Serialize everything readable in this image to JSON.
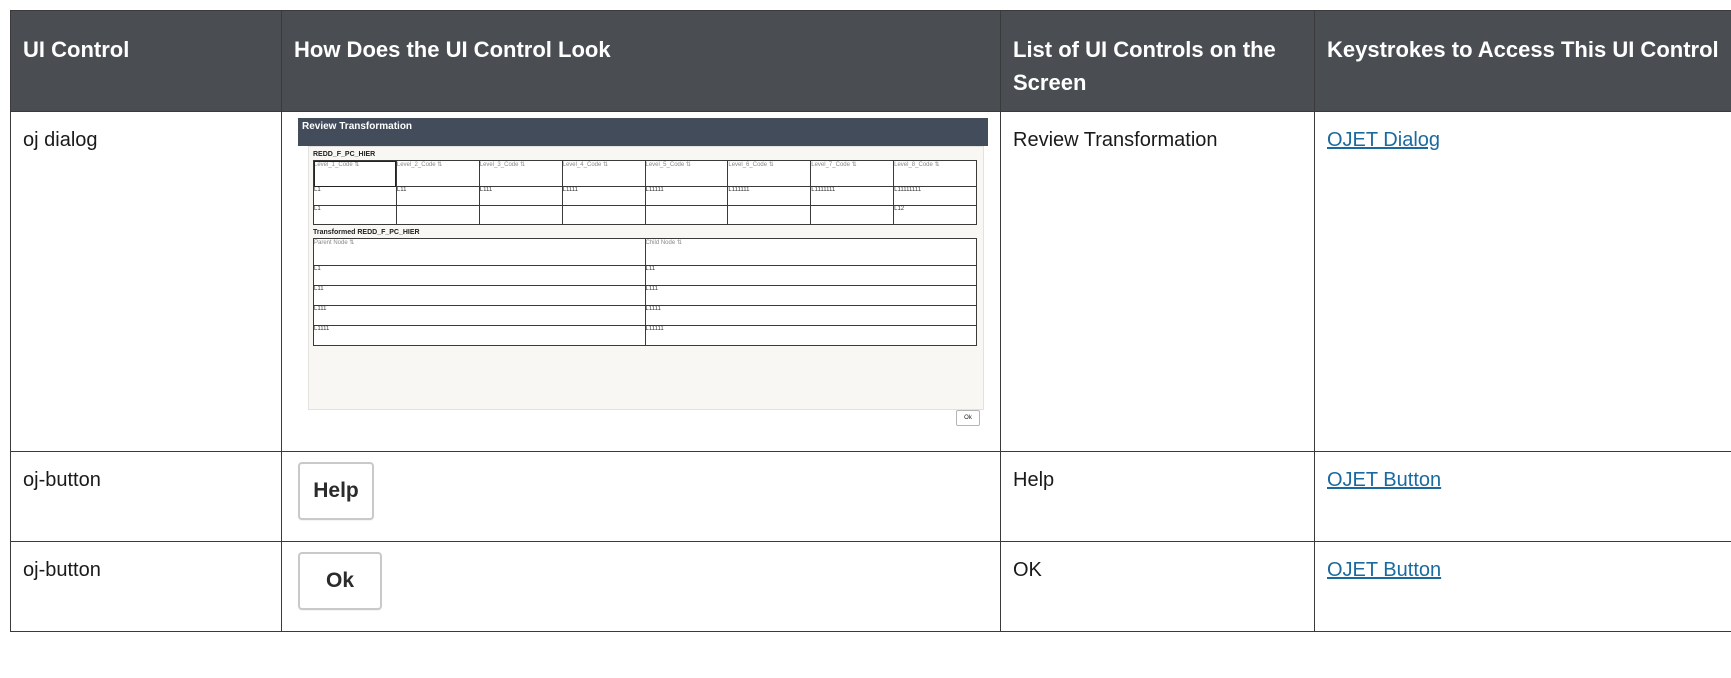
{
  "headers": [
    "UI Control",
    "How Does the UI Control Look",
    "List of UI Controls on the Screen",
    "Keystrokes to Access This UI Control"
  ],
  "rows": [
    {
      "control": "oj dialog",
      "list": "Review Transformation",
      "link": "OJET Dialog"
    },
    {
      "control": "oj-button",
      "list": "Help",
      "link": "OJET Button"
    },
    {
      "control": "oj-button",
      "list": "OK",
      "link": "OJET Button"
    }
  ],
  "dialog": {
    "title": "Review Transformation",
    "section1": "REDD_F_PC_HIER",
    "columns": [
      "Level_1_Code ⇅",
      "Level_2_Code ⇅",
      "Level_3_Code ⇅",
      "Level_4_Code ⇅",
      "Level_5_Code ⇅",
      "Level_6_Code ⇅",
      "Level_7_Code ⇅",
      "Level_8_Code ⇅"
    ],
    "table1_rows": [
      [
        "L1",
        "L11",
        "L111",
        "L1111",
        "L11111",
        "L111111",
        "L1111111",
        "L11111111"
      ],
      [
        "L1",
        "",
        "",
        "",
        "",
        "",
        "",
        "L12"
      ]
    ],
    "section2": "Transformed REDD_F_PC_HIER",
    "columns2": [
      "Parent Node ⇅",
      "Child Node ⇅"
    ],
    "table2_rows": [
      [
        "L1",
        "L11"
      ],
      [
        "L11",
        "L111"
      ],
      [
        "L111",
        "L1111"
      ],
      [
        "L1111",
        "L11111"
      ]
    ],
    "ok_label": "Ok"
  },
  "buttons": {
    "help_label": "Help",
    "ok_label": "Ok"
  }
}
